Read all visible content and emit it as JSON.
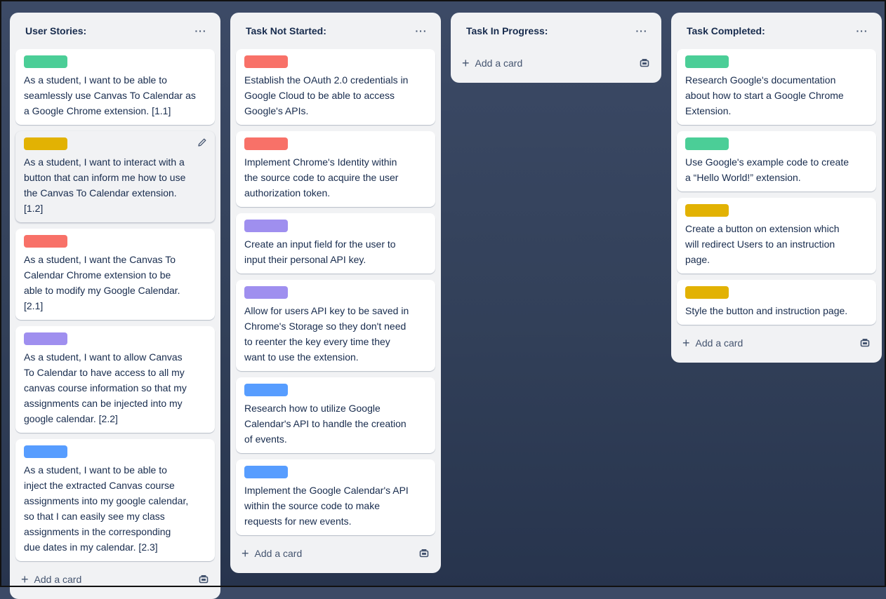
{
  "lists": [
    {
      "title": "User Stories:",
      "menu": "···",
      "add_card": "Add a card",
      "cards": [
        {
          "label_color": "#4bce97",
          "text": "As a student, I want to be able to\nseamlessly use Canvas To Calendar as\na Google Chrome extension. [1.1]"
        },
        {
          "label_color": "#e2b203",
          "text": "As a student, I want to interact with a\nbutton that can inform me how to use\nthe Canvas To Calendar extension.\n[1.2]",
          "hover": true,
          "edit_icon": "pencil-icon"
        },
        {
          "label_color": "#f87168",
          "text": "As a student, I want the Canvas To\nCalendar Chrome extension to be\nable to modify my Google Calendar.\n[2.1]"
        },
        {
          "label_color": "#9f8fef",
          "text": "As a student, I want to allow Canvas\nTo Calendar to have access to all my\ncanvas course information so that my\nassignments can be injected into my\ngoogle calendar. [2.2]"
        },
        {
          "label_color": "#579dff",
          "text": "As a student, I want to be able to\ninject the extracted Canvas course\nassignments into my google calendar,\nso that I can easily see my class\nassignments in the corresponding\ndue dates in my calendar. [2.3]"
        }
      ]
    },
    {
      "title": "Task Not Started:",
      "menu": "···",
      "add_card": "Add a card",
      "cards": [
        {
          "label_color": "#f87168",
          "text": "Establish the OAuth 2.0 credentials in\nGoogle Cloud to be able to access\nGoogle's APIs."
        },
        {
          "label_color": "#f87168",
          "text": "Implement Chrome's Identity within\nthe source code to acquire the user\nauthorization token."
        },
        {
          "label_color": "#9f8fef",
          "text": "Create an input field for the user to\ninput their personal API key."
        },
        {
          "label_color": "#9f8fef",
          "text": "Allow for users API key to be saved in\nChrome's Storage so they don't need\nto reenter the key every time they\nwant to use the extension."
        },
        {
          "label_color": "#579dff",
          "text": "Research how to utilize Google\nCalendar's API to handle the creation\nof events."
        },
        {
          "label_color": "#579dff",
          "text": "Implement the Google Calendar's API\nwithin the source code to make\nrequests for new events."
        }
      ]
    },
    {
      "title": "Task In Progress:",
      "menu": "···",
      "add_card": "Add a card",
      "cards": []
    },
    {
      "title": "Task Completed:",
      "menu": "···",
      "add_card": "Add a card",
      "cards": [
        {
          "label_color": "#4bce97",
          "text": "Research Google's documentation\nabout how to start a Google Chrome\nExtension."
        },
        {
          "label_color": "#4bce97",
          "text": "Use Google's example code to create\na “Hello World!” extension."
        },
        {
          "label_color": "#e2b203",
          "text": "Create a button on extension which\nwill redirect Users to an instruction\npage."
        },
        {
          "label_color": "#e2b203",
          "text": "Style the button and instruction page."
        }
      ]
    }
  ],
  "icons": {
    "add": "plus-icon",
    "template": "card-template-icon",
    "menu": "more-options-icon"
  }
}
